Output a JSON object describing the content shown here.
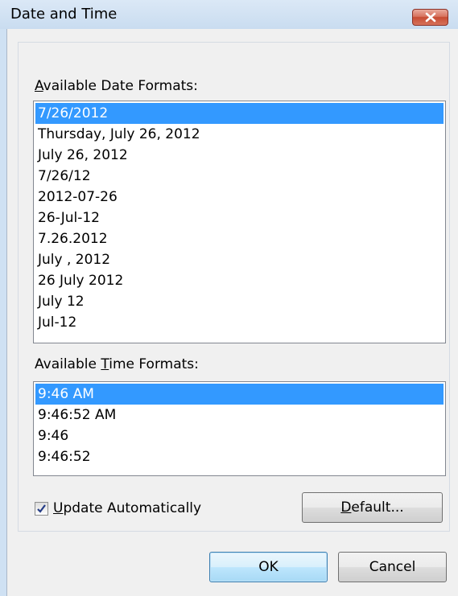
{
  "window": {
    "title": "Date and Time"
  },
  "date_formats": {
    "label_accel": "A",
    "label_rest": "vailable Date Formats:",
    "items": [
      {
        "text": "7/26/2012",
        "selected": true
      },
      {
        "text": "Thursday, July 26, 2012",
        "selected": false
      },
      {
        "text": "July 26, 2012",
        "selected": false
      },
      {
        "text": "7/26/12",
        "selected": false
      },
      {
        "text": "2012-07-26",
        "selected": false
      },
      {
        "text": "26-Jul-12",
        "selected": false
      },
      {
        "text": "7.26.2012",
        "selected": false
      },
      {
        "text": "July , 2012",
        "selected": false
      },
      {
        "text": "26 July 2012",
        "selected": false
      },
      {
        "text": "July 12",
        "selected": false
      },
      {
        "text": "Jul-12",
        "selected": false
      }
    ]
  },
  "time_formats": {
    "label_pre": "Available ",
    "label_accel": "T",
    "label_rest": "ime Formats:",
    "items": [
      {
        "text": "9:46 AM",
        "selected": true
      },
      {
        "text": "9:46:52 AM",
        "selected": false
      },
      {
        "text": "9:46",
        "selected": false
      },
      {
        "text": "9:46:52",
        "selected": false
      }
    ]
  },
  "update_automatically": {
    "checked": true,
    "label_accel": "U",
    "label_rest": "pdate Automatically"
  },
  "buttons": {
    "default_accel": "D",
    "default_rest": "efault...",
    "ok": "OK",
    "cancel": "Cancel"
  },
  "colors": {
    "selection": "#3399ff",
    "close_button": "#c74b33"
  },
  "icons": {
    "close": "close-icon",
    "checkmark": "checkmark-icon"
  }
}
